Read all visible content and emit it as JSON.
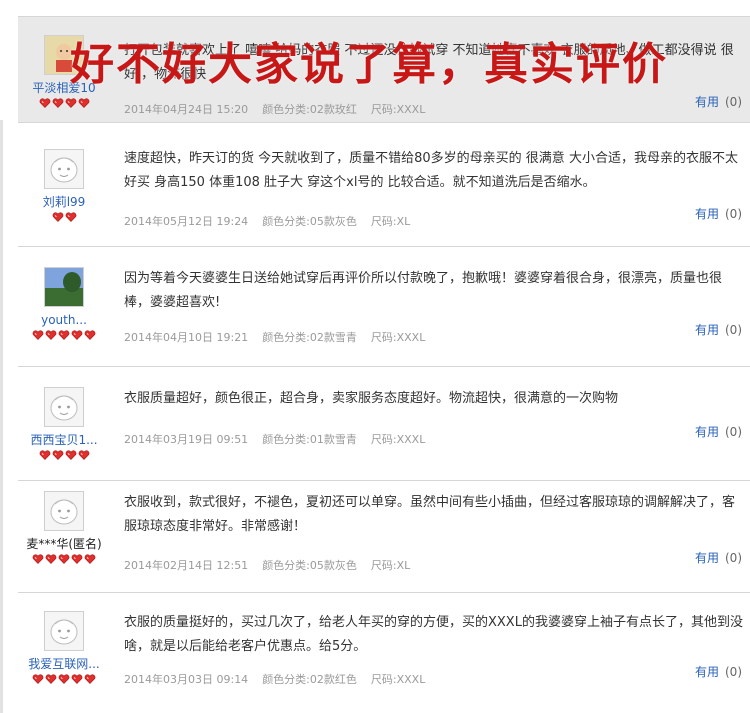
{
  "overlay": {
    "title": "好不好大家说了算，真实评价"
  },
  "useful_label": "有用",
  "useful_count": "(0)",
  "colors": {
    "accent_red": "#c81717",
    "link_blue": "#2a62b8",
    "meta_gray": "#9a9a9a"
  },
  "reviews": [
    {
      "user": "平淡相爱10",
      "hearts": 4,
      "avatar": "cartoon-avatar",
      "text": "打开包装就喜欢上了 嘻嘻 给妈的衣服 不过还没让她试穿 不知道她喜不喜欢 衣服的质地、做工都没得说 很好 ，物流很快",
      "date": "2014年04月24日 15:20",
      "color": "颜色分类:02款玫红",
      "size": "尺码:XXXL"
    },
    {
      "user": "刘莉l99",
      "hearts": 2,
      "avatar": "default-avatar",
      "text": "速度超快，昨天订的货 今天就收到了，质量不错给80多岁的母亲买的 很满意 大小合适，我母亲的衣服不太好买 身高150 体重108 肚子大 穿这个xl号的 比较合适。就不知道洗后是否缩水。",
      "date": "2014年05月12日 19:24",
      "color": "颜色分类:05款灰色",
      "size": "尺码:XL"
    },
    {
      "user": "youth...",
      "hearts": 5,
      "avatar": "photo-avatar",
      "text": "因为等着今天婆婆生日送给她试穿后再评价所以付款晚了，抱歉哦！婆婆穿着很合身，很漂亮，质量也很棒，婆婆超喜欢!",
      "date": "2014年04月10日 19:21",
      "color": "颜色分类:02款雪青",
      "size": "尺码:XXXL"
    },
    {
      "user": "西西宝贝1...",
      "hearts": 4,
      "avatar": "default-avatar",
      "text": "衣服质量超好，颜色很正，超合身，卖家服务态度超好。物流超快，很满意的一次购物",
      "date": "2014年03月19日 09:51",
      "color": "颜色分类:01款雪青",
      "size": "尺码:XXXL"
    },
    {
      "user": "麦***华(匿名)",
      "hearts": 5,
      "avatar": "default-avatar",
      "text": "衣服收到，款式很好，不褪色，夏初还可以单穿。虽然中间有些小插曲，但经过客服琼琼的调解解决了，客服琼琼态度非常好。非常感谢！",
      "date": "2014年02月14日 12:51",
      "color": "颜色分类:05款灰色",
      "size": "尺码:XL"
    },
    {
      "user": "我爱互联网...",
      "hearts": 5,
      "avatar": "default-avatar",
      "text": "衣服的质量挺好的，买过几次了，给老人年买的穿的方便，买的XXXL的我婆婆穿上袖子有点长了，其他到没啥，就是以后能给老客户优惠点。给5分。",
      "date": "2014年03月03日 09:14",
      "color": "颜色分类:02款红色",
      "size": "尺码:XXXL"
    }
  ]
}
